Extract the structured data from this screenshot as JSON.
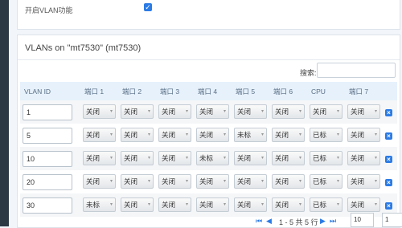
{
  "top": {
    "enable_label": "开启VLAN功能",
    "enable_checked": true
  },
  "vlan": {
    "title": "VLANs on \"mt7530\" (mt7530)",
    "search_label": "搜索:",
    "search_value": "",
    "headers": [
      "VLAN ID",
      "端口 1",
      "端口 2",
      "端口 3",
      "端口 4",
      "端口 5",
      "端口 6",
      "CPU",
      "端口 7"
    ],
    "rows": [
      {
        "id": "1",
        "ports": [
          "关闭",
          "关闭",
          "关闭",
          "关闭",
          "关闭",
          "关闭",
          "关闭",
          "关闭"
        ]
      },
      {
        "id": "5",
        "ports": [
          "关闭",
          "关闭",
          "关闭",
          "关闭",
          "未标",
          "关闭",
          "已标",
          "关闭"
        ]
      },
      {
        "id": "10",
        "ports": [
          "关闭",
          "关闭",
          "关闭",
          "未标",
          "关闭",
          "关闭",
          "已标",
          "关闭"
        ]
      },
      {
        "id": "20",
        "ports": [
          "关闭",
          "关闭",
          "关闭",
          "关闭",
          "关闭",
          "关闭",
          "已标",
          "关闭"
        ]
      },
      {
        "id": "30",
        "ports": [
          "未标",
          "关闭",
          "关闭",
          "关闭",
          "关闭",
          "关闭",
          "已标",
          "关闭"
        ]
      }
    ],
    "pagination": {
      "info": "1 - 5 共 5 行",
      "page_size": "10",
      "page": "1"
    }
  },
  "icons": {
    "check": "checkmark-icon",
    "delete": "delete-icon",
    "first": "first-page-icon",
    "prev": "prev-page-icon",
    "next": "next-page-icon",
    "last": "last-page-icon"
  },
  "colors": {
    "accent": "#2c7be5",
    "header_bg": "#e6f1fb"
  }
}
